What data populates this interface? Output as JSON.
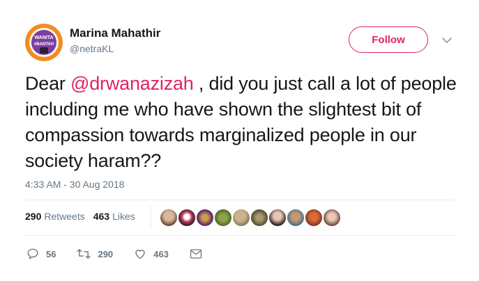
{
  "user": {
    "display_name": "Marina Mahathir",
    "handle": "@netraKL",
    "avatar_text_1": "WANITA",
    "avatar_text_2": "#BANTAH"
  },
  "follow_label": "Follow",
  "tweet": {
    "prefix": "Dear ",
    "mention": "@drwanazizah",
    "suffix": " , did you just call a lot of people including me who have shown the slightest bit of compassion towards marginalized people in our society haram??"
  },
  "timestamp": "4:33 AM - 30 Aug 2018",
  "stats": {
    "retweets_count": "290",
    "retweets_label": "Retweets",
    "likes_count": "463",
    "likes_label": "Likes"
  },
  "actions": {
    "reply_count": "56",
    "retweet_count": "290",
    "like_count": "463"
  },
  "colors": {
    "accent": "#e0245e",
    "muted": "#657786",
    "text": "#14171a"
  },
  "icons": [
    "chevron-down-icon",
    "reply-icon",
    "retweet-icon",
    "heart-icon",
    "message-icon"
  ]
}
